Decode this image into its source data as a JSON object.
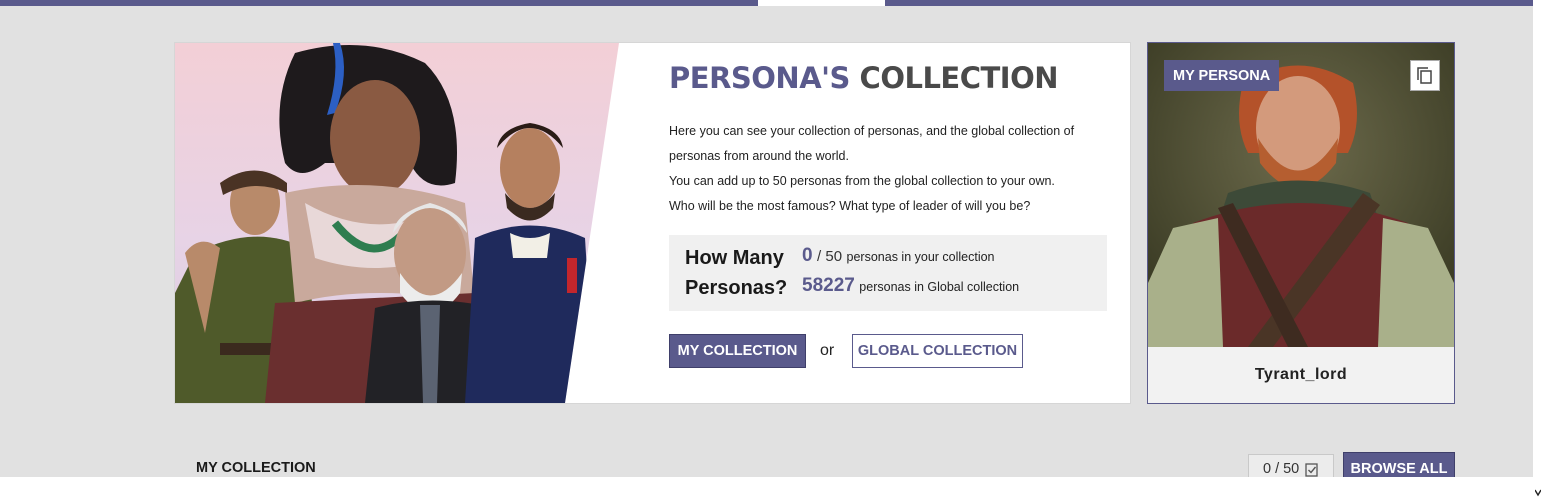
{
  "banner": {
    "title_part1": "PERSONA'S",
    "title_part2": "COLLECTION",
    "description": [
      "Here you can see your collection of personas, and the global collection of",
      "personas from around the world.",
      "You can add up to 50 personas from the global collection to your own.",
      "Who will be the most famous? What type of leader of will you be?"
    ],
    "stats": {
      "label_line1": "How Many",
      "label_line2": "Personas?",
      "my_count": "0",
      "my_max": "50",
      "my_suffix": "personas in your collection",
      "global_count": "58227",
      "global_suffix": "personas in Global collection"
    },
    "my_collection_button": "MY COLLECTION",
    "or_text": "or",
    "global_collection_button": "GLOBAL COLLECTION"
  },
  "persona_card": {
    "badge": "MY PERSONA",
    "name": "Tyrant_lord",
    "copy_icon": "copy-icon"
  },
  "my_collection_section": {
    "title": "MY COLLECTION",
    "count": "0",
    "max": "50",
    "checklist_icon": "checklist-icon",
    "browse_all_button": "BROWSE ALL"
  },
  "colors": {
    "accent": "#5a5a8c",
    "page_background": "#e1e1e1",
    "card_background": "#ffffff",
    "stats_background": "#f0f0f0"
  }
}
